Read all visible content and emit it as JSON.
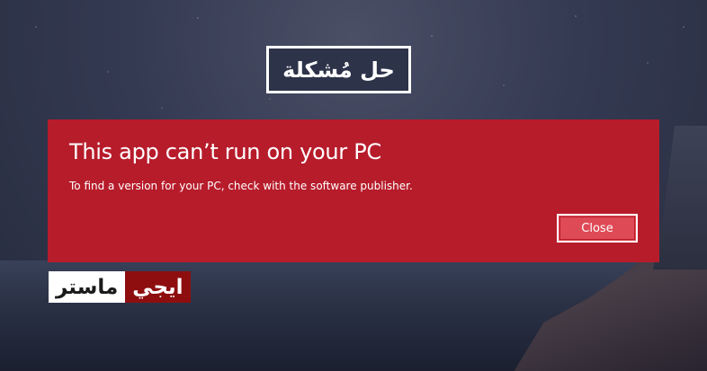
{
  "banner": {
    "text": "حل مُشكلة"
  },
  "dialog": {
    "title": "This app can’t run on your PC",
    "message": "To find a version for your PC, check with the software publisher.",
    "close_label": "Close",
    "background_color": "#b71c2b",
    "button_color": "#de4a56"
  },
  "logo": {
    "part1": "ماستر",
    "part2": "ايجي",
    "part1_bg": "#ffffff",
    "part2_bg": "#8e0e10"
  }
}
